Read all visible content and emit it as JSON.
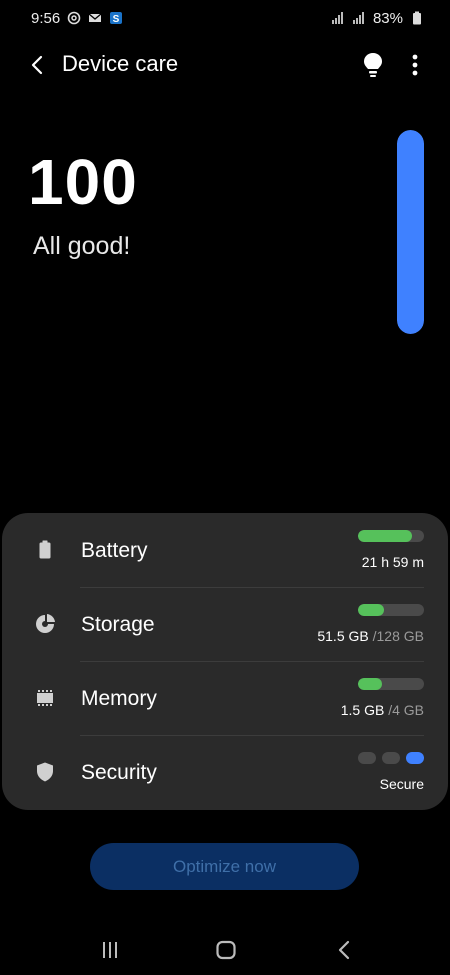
{
  "status_bar": {
    "time": "9:56",
    "battery_percent": "83%",
    "notification_icons": [
      "at-sign-icon",
      "mail-icon",
      "app-s-icon"
    ],
    "signal_icons": [
      "signal-icon",
      "signal-icon"
    ]
  },
  "app_bar": {
    "title": "Device care",
    "back_icon": "chevron-left-icon",
    "tips_icon": "lightbulb-icon",
    "more_icon": "more-vertical-icon"
  },
  "score": {
    "value": "100",
    "status": "All good!",
    "level": 1.0,
    "bar_color": "#3f81ff"
  },
  "items": {
    "battery": {
      "label": "Battery",
      "icon": "battery-icon",
      "value": "21 h 59 m",
      "level": 0.82
    },
    "storage": {
      "label": "Storage",
      "icon": "pie-chart-icon",
      "used": "51.5 GB ",
      "total": "/128 GB",
      "level": 0.4
    },
    "memory": {
      "label": "Memory",
      "icon": "chip-icon",
      "used": "1.5 GB ",
      "total": "/4 GB",
      "level": 0.37
    },
    "security": {
      "label": "Security",
      "icon": "shield-icon",
      "value": "Secure",
      "level_dots": 3,
      "active_dot": 3
    }
  },
  "optimize_button": {
    "label": "Optimize now"
  },
  "nav_bar": {
    "recents_icon": "recents-icon",
    "home_icon": "home-icon",
    "back_icon": "back-icon"
  },
  "colors": {
    "accent": "#3f81ff",
    "good": "#56c15b",
    "card": "#2a2a2a",
    "background": "#000000"
  }
}
